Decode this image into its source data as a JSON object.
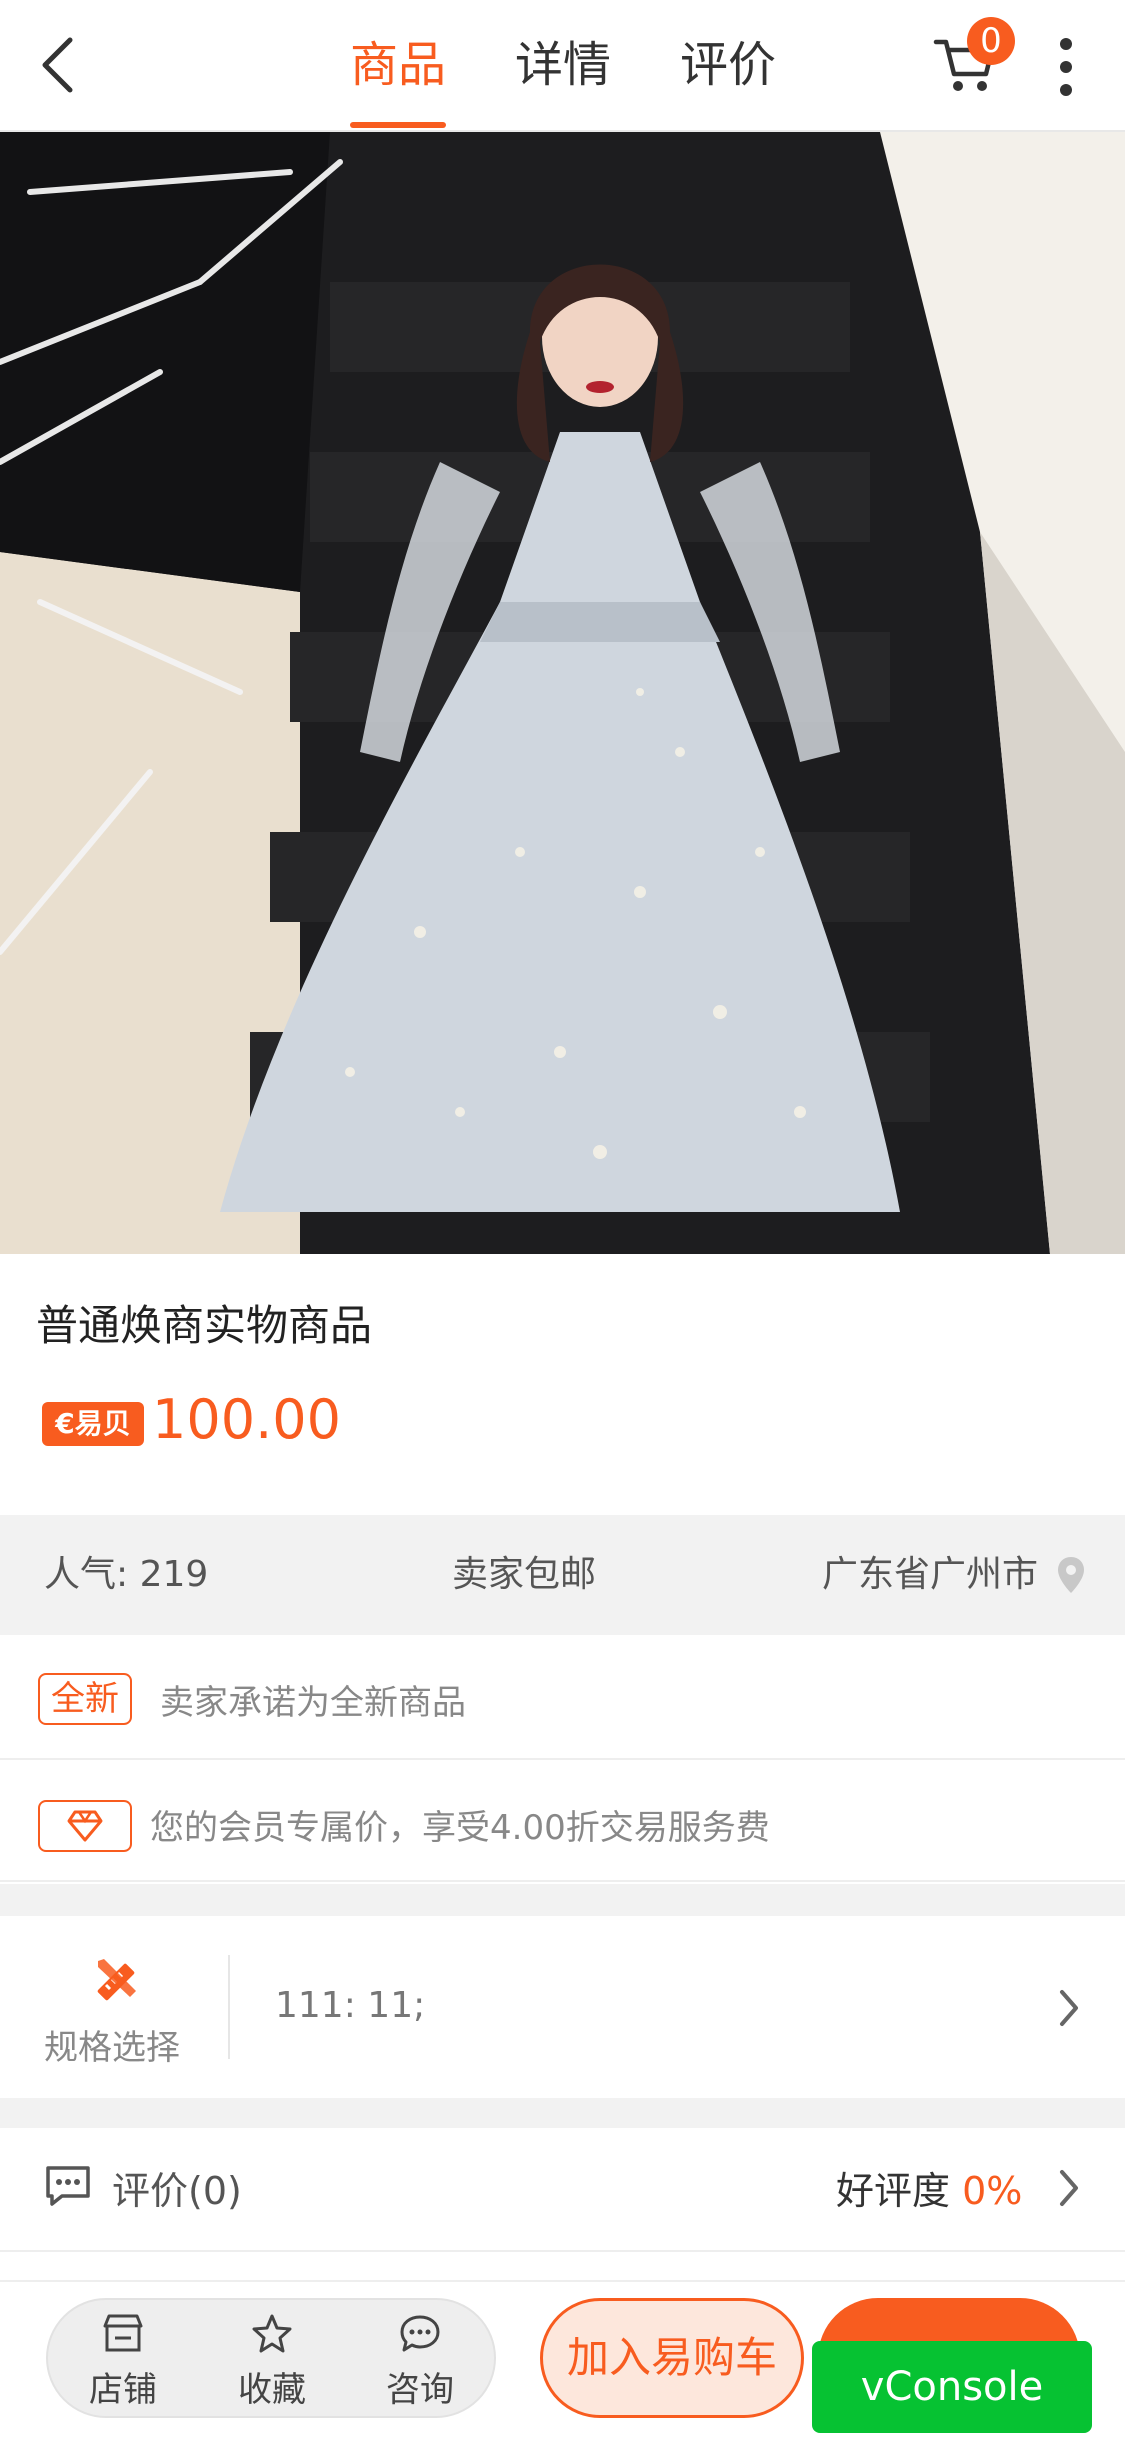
{
  "header": {
    "tabs": [
      {
        "label": "商品",
        "active": true
      },
      {
        "label": "详情",
        "active": false
      },
      {
        "label": "评价",
        "active": false
      }
    ],
    "cart_count": "0",
    "icons": {
      "back": "back-arrow-icon",
      "cart": "cart-icon",
      "more": "more-vertical-icon"
    }
  },
  "product": {
    "title": "普通焕商实物商品",
    "currency_tag": "€易贝",
    "price": "100.00"
  },
  "info_row": {
    "popularity": "人气: 219",
    "shipping": "卖家包邮",
    "location": "广东省广州市"
  },
  "promises": {
    "new_tag": "全新",
    "new_text": "卖家承诺为全新商品",
    "member_text": "您的会员专属价，享受4.00折交易服务费"
  },
  "spec": {
    "label": "规格选择",
    "value": "111: 11;"
  },
  "reviews": {
    "label": "评价(0)",
    "rating_label": "好评度",
    "rating_value": "0%"
  },
  "bottom_bar": {
    "shop": "店铺",
    "favorite": "收藏",
    "consult": "咨询",
    "add_to_cart": "加入易购车",
    "vconsole": "vConsole"
  },
  "colors": {
    "accent": "#f85c1f",
    "vconsole": "#06c232"
  }
}
